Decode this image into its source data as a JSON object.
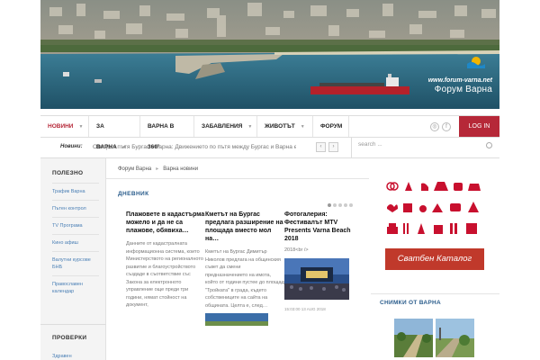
{
  "header": {
    "site_url": "www.forum-varna.net",
    "site_name": "Форум Варна"
  },
  "nav": {
    "items": [
      {
        "label": "НОВИНИ",
        "has_dropdown": true,
        "active": true
      },
      {
        "label": "ЗА ВАРНА",
        "has_dropdown": true,
        "active": false
      },
      {
        "label": "ВАРНА В 360°",
        "has_dropdown": false,
        "active": false
      },
      {
        "label": "ЗАБАВЛЕНИЯ",
        "has_dropdown": true,
        "active": false
      },
      {
        "label": "ЖИВОТЪТ",
        "has_dropdown": true,
        "active": false
      },
      {
        "label": "ФОРУМ",
        "has_dropdown": false,
        "active": false
      }
    ],
    "login_label": "LOG IN",
    "accent_color": "#b62838"
  },
  "newsbar": {
    "label": "Новини:",
    "headline": "Отворих пътя Бургас - Варна: Движението по пътя между Бургас и Варна е",
    "prev": "‹",
    "next": "›",
    "search_placeholder": "search ..."
  },
  "sidebar": {
    "title": "ПОЛЕЗНО",
    "items": [
      "Трафик Варна",
      "Пътен контрол",
      "TV Програма",
      "Кино афиш",
      "Валутни курсове БНБ",
      "Православен календар"
    ],
    "second_title": "ПРОВЕРКИ",
    "second_item": "Здравен"
  },
  "main": {
    "breadcrumb": [
      "Форум Варна",
      "Варна новини"
    ],
    "section_title": "ДНЕВНИК",
    "articles": [
      {
        "title": "Плажовете в кадастърма можело и да не са плажове, обявиха…",
        "body": "Данните от кадастралната информационна система, които Министерството на регионалното развитие и благоустройството създаде в съответствие със Закона за електронното управление още преди три години, нямат стойност на документ,"
      },
      {
        "title": "Кметът на Бургас предлага разширение на площада вместо мол на…",
        "body": "Кметът на Бургас Димитър Николов предлага на общинския съвет да смени предназначението на имота, който от години пустее до площад \"Тройката\" в града, където собствениците на сайта на общината. Целта е, след…"
      },
      {
        "title": "Фотогалерия: Фестивалът MTV Presents Varna Beach 2018",
        "body": "2018<br />",
        "meta": "15:03:00 13 AUG 2018"
      }
    ]
  },
  "right": {
    "catalog_label": "Сватбен Каталог",
    "photos_title": "СНИМКИ ОТ ВАРНА"
  }
}
